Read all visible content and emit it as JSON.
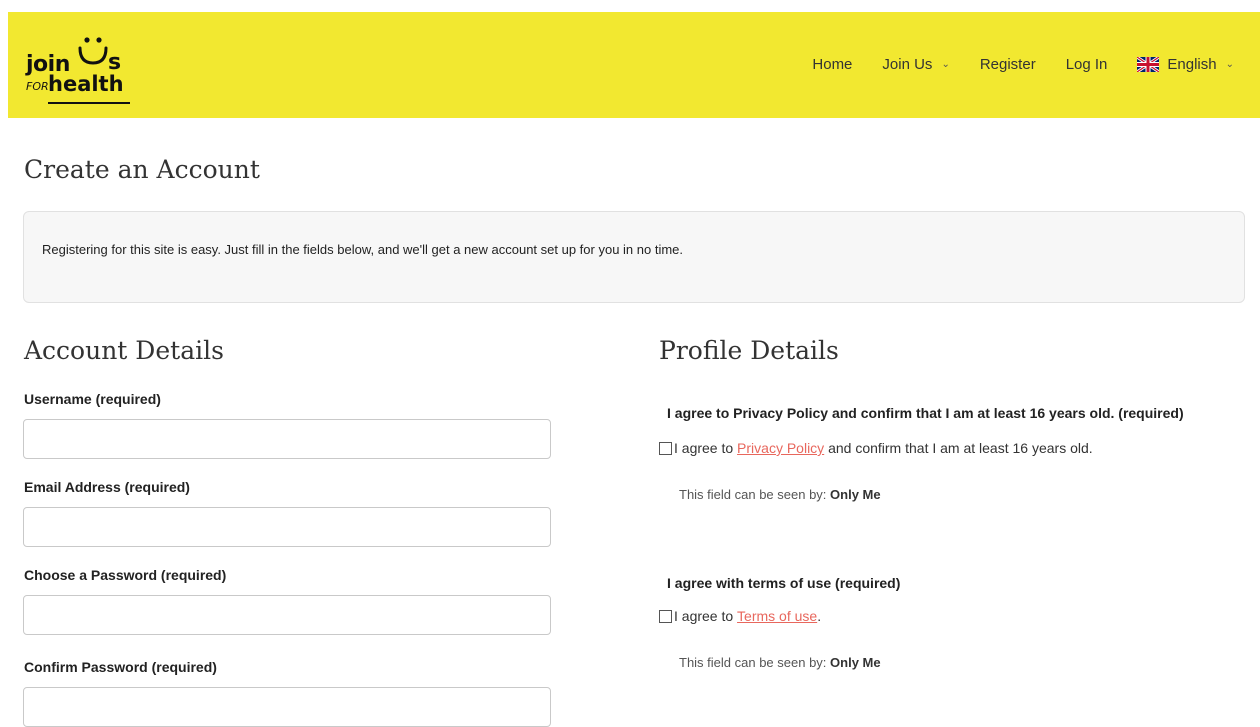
{
  "header": {
    "logo": {
      "word1": "join",
      "word2": "s",
      "small": "FOR",
      "word3": "health"
    },
    "nav": {
      "home": "Home",
      "join_us": "Join Us",
      "register": "Register",
      "login": "Log In",
      "language": "English"
    }
  },
  "page": {
    "title": "Create an Account",
    "intro": "Registering for this site is easy. Just fill in the fields below, and we'll get a new account set up for you in no time."
  },
  "account": {
    "title": "Account Details",
    "username_label": "Username (required)",
    "username_value": "",
    "email_label": "Email Address (required)",
    "email_value": "",
    "password_label": "Choose a Password (required)",
    "confirm_label": "Confirm Password (required)"
  },
  "profile": {
    "title": "Profile Details",
    "privacy_field_label": "I agree to Privacy Policy and confirm that I am at least 16 years old. (required)",
    "privacy_pre": "I agree to ",
    "privacy_link": "Privacy Policy",
    "privacy_post": " and confirm that I am at least 16 years old.",
    "terms_field_label": "I agree with terms of use (required)",
    "terms_pre": "I agree to ",
    "terms_link": "Terms of use",
    "terms_post": ".",
    "visibility_prefix": "This field can be seen by: ",
    "visibility_value": "Only Me"
  },
  "colors": {
    "header_bg": "#f2e830",
    "link": "#e8675d"
  },
  "icons": {
    "dropdown": "chevron-down-icon",
    "language_flag": "uk-flag-icon"
  }
}
